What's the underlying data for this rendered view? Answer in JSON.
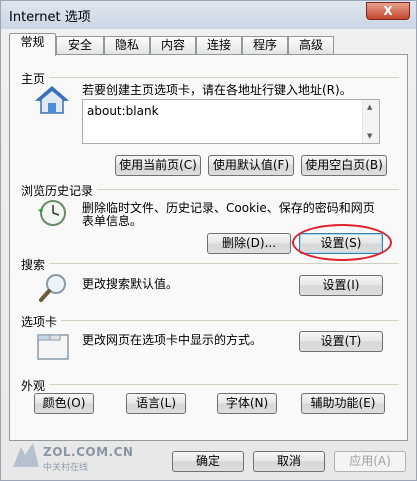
{
  "window": {
    "title": "Internet 选项",
    "close_label": "X"
  },
  "tabs": [
    "常规",
    "安全",
    "隐私",
    "内容",
    "连接",
    "程序",
    "高级"
  ],
  "home": {
    "group_label": "主页",
    "description": "若要创建主页选项卡，请在各地址行键入地址(R)。",
    "url_value": "about:blank",
    "buttons": [
      "使用当前页(C)",
      "使用默认值(F)",
      "使用空白页(B)"
    ]
  },
  "history": {
    "group_label": "浏览历史记录",
    "description_line1": "删除临时文件、历史记录、Cookie、保存的密码和网页",
    "description_line2": "表单信息。",
    "delete_button": "删除(D)...",
    "settings_button": "设置(S)"
  },
  "search": {
    "group_label": "搜索",
    "description": "更改搜索默认值。",
    "settings_button": "设置(I)"
  },
  "tabbed": {
    "group_label": "选项卡",
    "description": "更改网页在选项卡中显示的方式。",
    "settings_button": "设置(T)"
  },
  "appearance": {
    "group_label": "外观",
    "buttons": [
      "颜色(O)",
      "语言(L)",
      "字体(N)",
      "辅助功能(E)"
    ]
  },
  "footer": {
    "ok": "确定",
    "cancel": "取消",
    "apply": "应用(A)"
  },
  "watermark": {
    "main": "ZOL.COM.CN",
    "sub": "中关村在线"
  },
  "colors": {
    "highlight_ring": "#e0202a",
    "panel_bg": "#f9f9f9"
  }
}
